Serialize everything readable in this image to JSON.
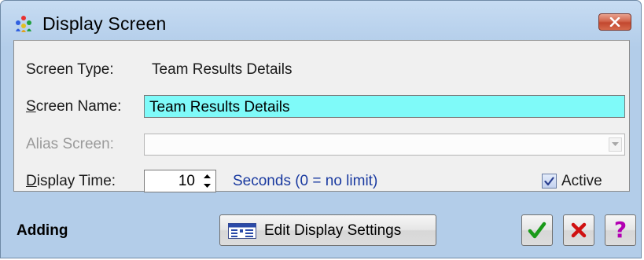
{
  "window": {
    "title": "Display Screen",
    "icon": "people-group-icon"
  },
  "form": {
    "screen_type_label": "Screen Type:",
    "screen_type_value": "Team Results Details",
    "screen_name_label_mnemonic": "S",
    "screen_name_label_rest": "creen Name:",
    "screen_name_value": "Team Results Details",
    "alias_label": "Alias Screen:",
    "alias_value": "",
    "display_time_label_mnemonic": "D",
    "display_time_label_rest": "isplay Time:",
    "display_time_value": "10",
    "display_time_note": "Seconds (0 = no limit)",
    "active_label": "Active",
    "active_checked": true
  },
  "footer": {
    "status": "Adding",
    "edit_settings_label": "Edit Display Settings",
    "ok_icon": "checkmark-icon",
    "cancel_icon": "x-icon",
    "help_label": "?"
  },
  "colors": {
    "name_field_bg": "#7ffaf9",
    "note_text": "#1a3aa0",
    "ok_green": "#1a9a1a",
    "cancel_red": "#d01010",
    "help_magenta": "#b300b3"
  }
}
